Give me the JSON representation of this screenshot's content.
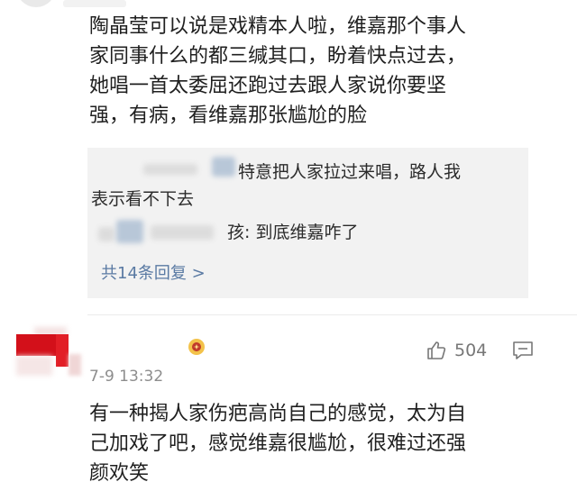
{
  "comment1": {
    "text": "陶晶莹可以说是戏精本人啦，维嘉那个事人\n家同事什么的都三缄其口，盼着快点过去，\n她唱一首太委屈还跑过去跟人家说你要坚\n强，有病，看维嘉那张尴尬的脸"
  },
  "replies": {
    "reply1_text_a": "特意把人家拉过来唱，路人我",
    "reply1_text_b": "表示看不下去",
    "reply2_text": "孩: 到底维嘉咋了",
    "more_link": "共14条回复 >"
  },
  "comment2": {
    "time": "7-9 13:32",
    "likes": "504",
    "text": "有一种揭人家伤疤高尚自己的感觉，太为自\n己加戏了吧，感觉维嘉很尴尬，很难过还强\n颜欢笑"
  },
  "colors": {
    "link": "#5a7aa3",
    "reply_bg": "#f2f2f2",
    "text": "#1f1f1f",
    "meta": "#8d8d8d"
  },
  "icons": [
    "like-icon",
    "comment-icon",
    "user-badge-icon"
  ]
}
